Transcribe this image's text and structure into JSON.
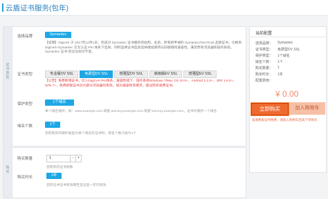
{
  "page": {
    "title": "云盾证书服务(包年)"
  },
  "stripes": {
    "cert": "证书类型",
    "qty": "购买"
  },
  "brand": {
    "label": "选择品牌",
    "value": "Symantec"
  },
  "brand_desc": "【说明】Digicert 于 2017年12月1日，完成对 Symantec 证书服务的收购，此后，所有新申请的 Symantec/GeoTrust 品牌证书，切换到 Digicert+Symantec 交叉认证 PKI 体系下签发，同时品牌证书签发后将继续保持与旧版相同兼容性，满足原有浏览器和操作系统，Symantec 证书 的信任标识不变。",
  "cert_type": {
    "label": "证书类型",
    "tabs": [
      "专业版OV SSL",
      "免费型DV SSL",
      "增强型OV SSL",
      "高级版EV SSL",
      "增强型EV SSL"
    ],
    "selected": 1
  },
  "announcement": "【公告】免费新增证书，切入DigiCert PKI体系，兼容性如下：操作系统Windows 7/Mac OS 10.5+，Android 2.3.3+，JRE 1.6.5+，WIN 7+，免费新版证书对大部分浏览器均有效，如对兼容性有要求，建议购买收费证书。",
  "protect_type": {
    "label": "保护类型",
    "value": "1个域名",
    "hint": "单个域名保护，如：www.example.com,或者 test.buy.example.com,或者 test.buy.example.com，证书可保护一个域名"
  },
  "domain_count": {
    "label": "域名个数",
    "value": "1个",
    "hint": "您的购买的保护类型为单个域名的证书时，域名个数只能为1个"
  },
  "quantity": {
    "label": "购买数量",
    "value": "1",
    "minus": "-",
    "plus": "+",
    "hint": "您购买的证书张数"
  },
  "duration": {
    "label": "购买时长",
    "value": "1年",
    "hint": "您的证书证书有效期至签证后一年内有效"
  },
  "summary": {
    "title": "当前配置",
    "rows": [
      {
        "k": "选择品牌：",
        "v": "Symantec"
      },
      {
        "k": "证书类型：",
        "v": "免费型DV SSL"
      },
      {
        "k": "保护类型：",
        "v": "1个域名"
      },
      {
        "k": "域名个数：",
        "v": "1个"
      },
      {
        "k": "购买数量：",
        "v": "1"
      },
      {
        "k": "购买时长：",
        "v": "1年"
      },
      {
        "k": "配置费用：",
        "v": ""
      }
    ],
    "price": "¥ 0.00",
    "buy_label": "立即购买",
    "cart_label": "加入购物车",
    "note": "该收费类证书免费，请加入购物车后再下单购买"
  },
  "colors": {
    "accent": "#1ea7e4",
    "buy": "#ee6a2f",
    "price": "#f38b6e"
  }
}
